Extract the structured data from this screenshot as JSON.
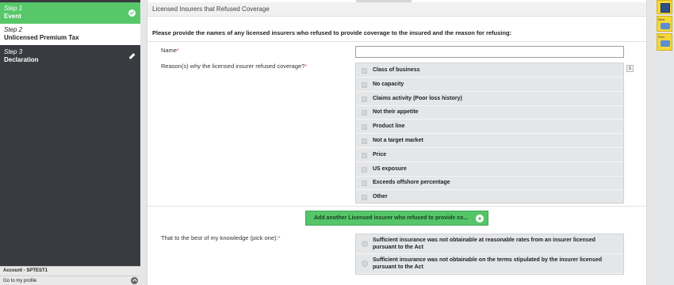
{
  "sidebar": {
    "steps": [
      {
        "num": "Step 1",
        "label": "Event",
        "state": "complete"
      },
      {
        "num": "Step 2",
        "label": "Unlicensed Premium Tax",
        "state": "current"
      },
      {
        "num": "Step 3",
        "label": "Declaration",
        "state": "editable"
      }
    ],
    "account": "Account - SPTEST1",
    "profile_link": "Go to my profile"
  },
  "form": {
    "section_title": "Licensed Insurers that Refused Coverage",
    "instructions": "Please provide the names of any licensed insurers who refused to provide coverage to the insured and the reason for refusing:",
    "name_label": "Name",
    "name_value": "",
    "reason_label": "Reason(s) why the licensed insurer refused coverage?",
    "info_icon": "i",
    "reasons": [
      "Class of business",
      "No capacity",
      "Claims activity (Poor loss history)",
      "Not their appetite",
      "Product line",
      "Not a target market",
      "Price",
      "US exposure",
      "Exceeds offshore percentage",
      "Other"
    ],
    "add_button": "Add another Licensed insurer who refused to provide co...",
    "add_icon": "+",
    "pick_label": "That to the best of my knowledge (pick one):",
    "options": [
      "Sufficient insurance was not obtainable at reasonable rates from an insurer licensed pursuant to the Act",
      "Sufficient insurance was not obtainable on the terms stipulated by the insurer licensed pursuant to the Act"
    ],
    "required_marker": "*"
  },
  "toolbar": {
    "save_icon": "floppy-disk-icon",
    "next_label": "Next",
    "prev_label": "Prev"
  },
  "colors": {
    "step_complete": "#57c76a",
    "sidebar_bg": "#383c40",
    "add_button": "#55c56a",
    "toolbar": "#f5d73a"
  }
}
